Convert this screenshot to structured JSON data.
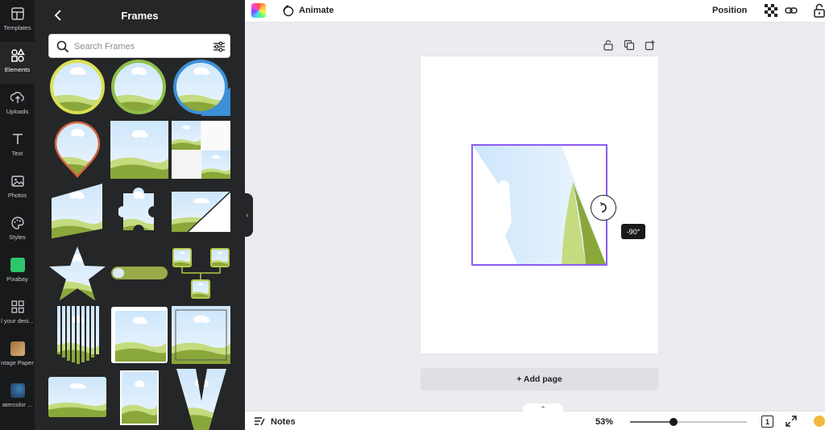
{
  "rail": {
    "items": [
      {
        "label": "Templates",
        "icon": "templates-icon"
      },
      {
        "label": "Elements",
        "icon": "elements-icon"
      },
      {
        "label": "Uploads",
        "icon": "uploads-icon"
      },
      {
        "label": "Text",
        "icon": "text-icon"
      },
      {
        "label": "Photos",
        "icon": "photos-icon"
      },
      {
        "label": "Styles",
        "icon": "styles-icon"
      },
      {
        "label": "Pixabay",
        "icon": "pixabay-icon"
      },
      {
        "label": "l your desi...",
        "icon": "apps-icon"
      },
      {
        "label": "ntage Paper",
        "icon": "vintage-paper-icon"
      },
      {
        "label": "atercolor ...",
        "icon": "watercolor-icon"
      }
    ],
    "active": "Elements"
  },
  "panel": {
    "title": "Frames",
    "search_placeholder": "Search Frames"
  },
  "topbar": {
    "animate_label": "Animate",
    "position_label": "Position"
  },
  "canvas": {
    "rotation_tooltip": "-90°",
    "add_page_label": "+ Add page"
  },
  "bottombar": {
    "notes_label": "Notes",
    "zoom_label": "53%",
    "zoom_value": 53,
    "page_count": "1"
  },
  "colors": {
    "rail_bg": "#18191b",
    "panel_bg": "#252627",
    "selection": "#8b5cf6",
    "grass": "#8fb03a",
    "sky": "#cfe7fb"
  }
}
